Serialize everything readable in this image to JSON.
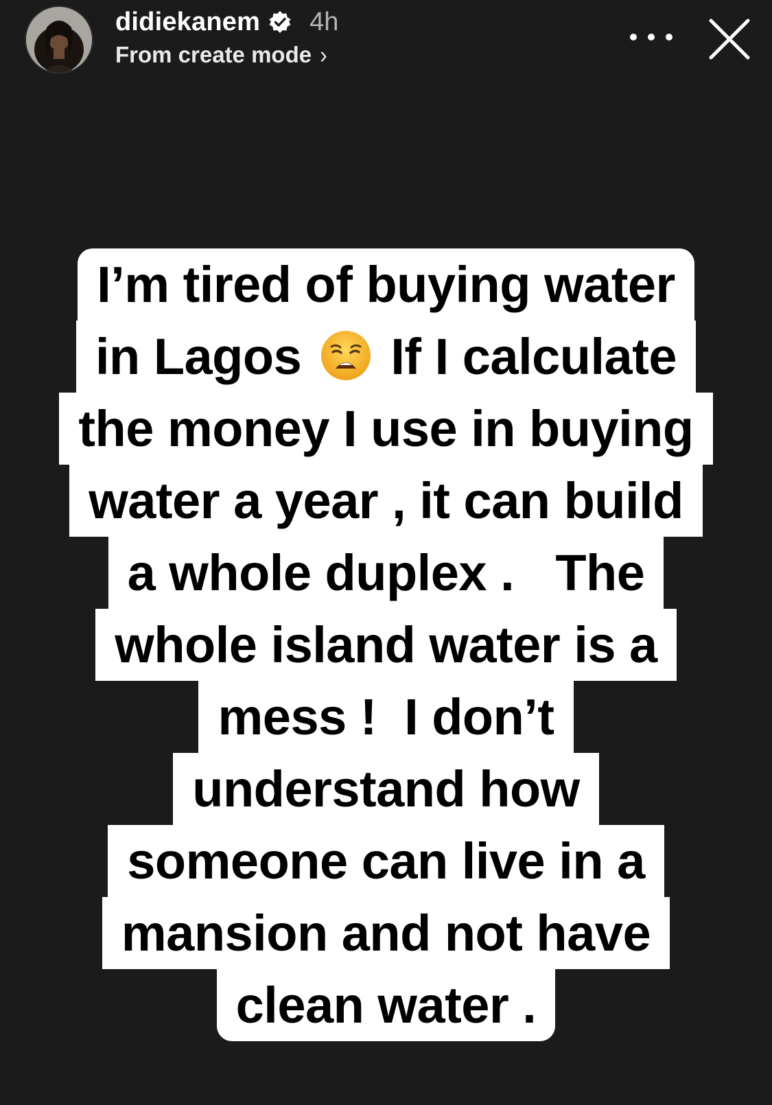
{
  "header": {
    "username": "didiekanem",
    "verified": true,
    "time_ago": "4h",
    "subline": "From create mode",
    "subline_chevron": "›",
    "more_icon": "more-horizontal-icon",
    "close_icon": "close-icon"
  },
  "sticker": {
    "lines": [
      "I’m tired of buying water",
      "in Lagos",
      "If I calculate",
      "the money I use in buying",
      "water a year , it can build",
      "a whole duplex .   The",
      "whole island water is a",
      "mess !  I don’t",
      "understand how",
      "someone can live in a",
      "mansion and not have",
      "clean water ."
    ],
    "emoji": "weary-face-emoji"
  },
  "colors": {
    "background": "#1b1b1b",
    "sticker_bg": "#ffffff",
    "sticker_text": "#000000",
    "verified_badge": "#ffffff"
  }
}
